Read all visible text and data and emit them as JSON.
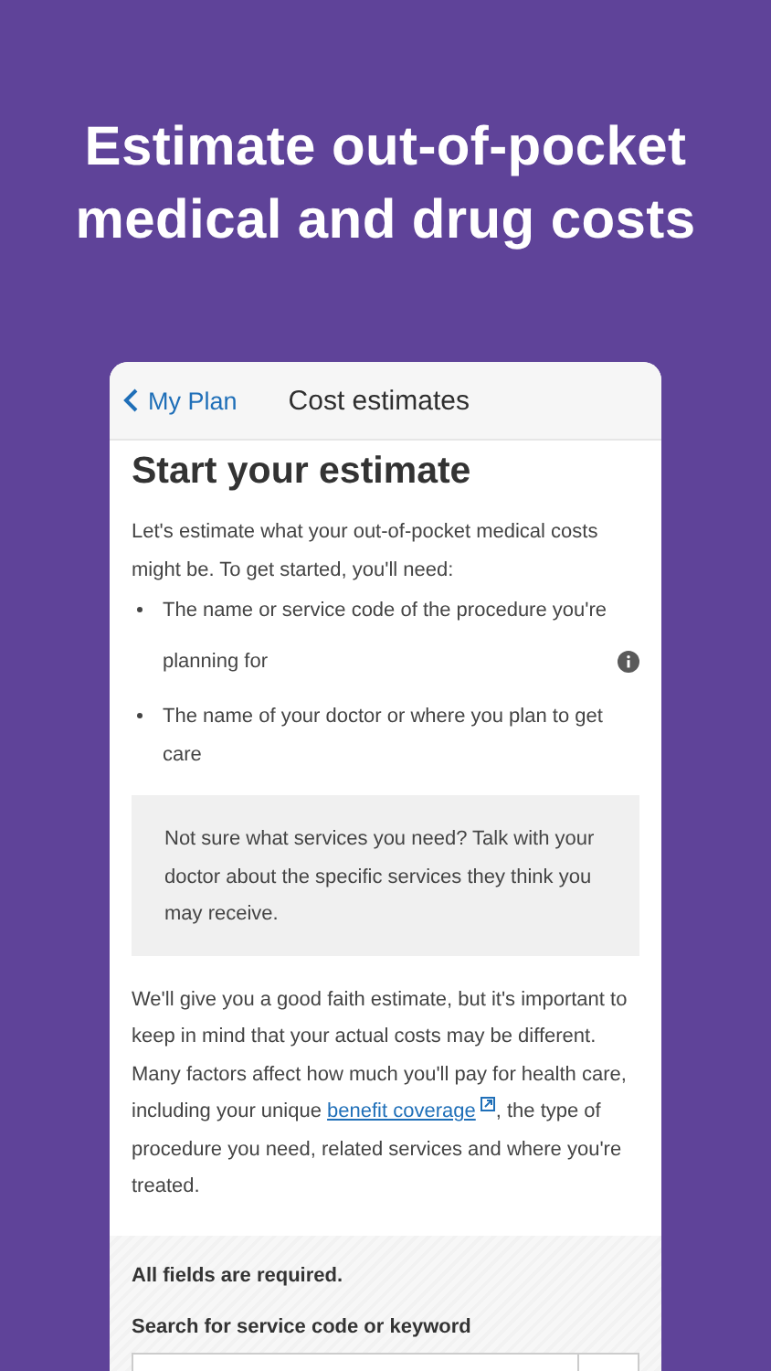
{
  "headline": "Estimate out-of-pocket medical and drug costs",
  "nav": {
    "back": "My Plan",
    "title": "Cost estimates"
  },
  "heading": "Start your estimate",
  "intro": "Let's estimate what your out-of-pocket medical costs might be. To get started, you'll need:",
  "needs": [
    {
      "text": "The name or service code of the procedure you're planning for",
      "info": true
    },
    {
      "text": "The name of your doctor or where you plan to get care",
      "info": false
    }
  ],
  "tip": "Not sure what services you need? Talk with your doctor about the specific services they think you may receive.",
  "disclaimer": {
    "before": "We'll give you a good faith estimate, but it's important to keep in mind that your actual costs may be different. Many factors affect how much you'll pay for health care, including your unique",
    "link": "benefit coverage",
    "after": ", the type of procedure you need, related services and where you're treated."
  },
  "form": {
    "required_note": "All fields are required.",
    "search_label": "Search for service code or keyword"
  }
}
